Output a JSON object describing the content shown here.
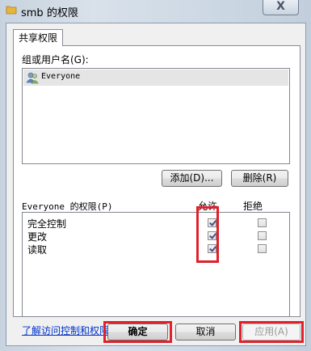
{
  "window": {
    "title": "smb 的权限",
    "close_label": "X"
  },
  "tabs": [
    {
      "label": "共享权限"
    }
  ],
  "group_label": "组或用户名(G):",
  "users": [
    {
      "name": "Everyone"
    }
  ],
  "buttons": {
    "add": "添加(D)...",
    "remove": "删除(R)",
    "ok": "确定",
    "cancel": "取消",
    "apply": "应用(A)"
  },
  "permissions": {
    "header_label": "Everyone 的权限(P)",
    "allow_header": "允许",
    "deny_header": "拒绝",
    "rows": [
      {
        "name": "完全控制",
        "allow": true,
        "deny": false
      },
      {
        "name": "更改",
        "allow": true,
        "deny": false
      },
      {
        "name": "读取",
        "allow": true,
        "deny": false
      }
    ]
  },
  "help_link": "了解访问控制和权限",
  "colors": {
    "highlight": "#e0202a",
    "link": "#0033cc"
  }
}
